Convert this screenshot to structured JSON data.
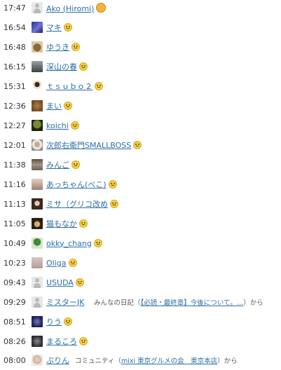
{
  "entries": [
    {
      "time": "17:47",
      "name": "Ako (Hiromi)",
      "badge": "gold"
    },
    {
      "time": "16:54",
      "name": "マキ"
    },
    {
      "time": "16:48",
      "name": "ゆうき"
    },
    {
      "time": "16:15",
      "name": "深山の春"
    },
    {
      "time": "15:31",
      "name": "ｔｓｕｂｏ２"
    },
    {
      "time": "12:36",
      "name": "まい"
    },
    {
      "time": "12:27",
      "name": "koichi"
    },
    {
      "time": "12:01",
      "name": "次郎右衛門SMALLBOSS"
    },
    {
      "time": "11:38",
      "name": "みんご"
    },
    {
      "time": "11:16",
      "name": "あっちゃん(べこ)"
    },
    {
      "time": "11:13",
      "name": "ミサ（グリコ改め"
    },
    {
      "time": "11:05",
      "name": "猫もなか"
    },
    {
      "time": "10:49",
      "name": "okky_chang"
    },
    {
      "time": "10:23",
      "name": "Oliga"
    },
    {
      "time": "09:43",
      "name": "USUDA"
    },
    {
      "time": "09:29",
      "name": "ミスターJK",
      "desc_prefix": "みんなの日記（",
      "desc_link": "【必読・最終章】今後について。…",
      "desc_suffix": "）から"
    },
    {
      "time": "08:51",
      "name": "りう"
    },
    {
      "time": "08:26",
      "name": "まるころ"
    },
    {
      "time": "08:00",
      "name": "ぷりん",
      "desc_prefix": "コミュニティ（",
      "desc_link": "mixi 東京グルメの会　東京本店",
      "desc_suffix": "）から"
    }
  ]
}
